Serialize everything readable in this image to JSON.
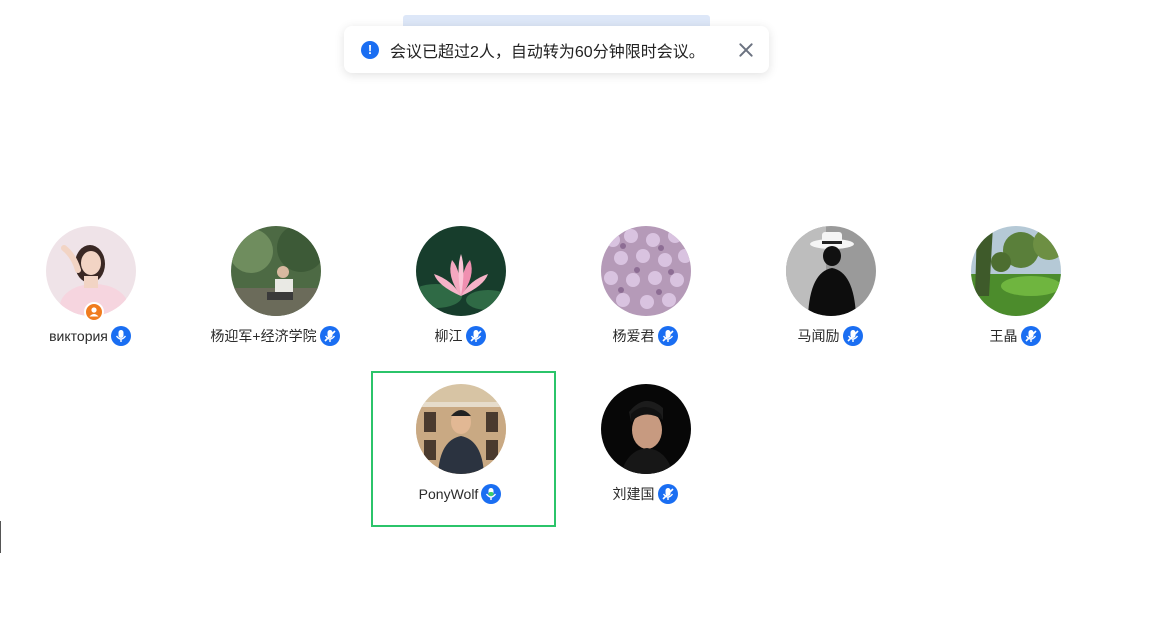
{
  "toast": {
    "message": "会议已超过2人，自动转为60分钟限时会议。",
    "info_icon": "info-icon",
    "close_icon": "close-icon"
  },
  "colors": {
    "accent": "#1a6ef2",
    "active_speaker": "#2bc46a",
    "host_badge": "#f07c1e"
  },
  "participants": [
    {
      "name": "виктория",
      "mic": "mic-active-icon",
      "host": true
    },
    {
      "name": "杨迎军+经济学院",
      "mic": "mic-muted-icon"
    },
    {
      "name": "柳江",
      "mic": "mic-muted-icon"
    },
    {
      "name": "杨爱君",
      "mic": "mic-muted-icon"
    },
    {
      "name": "马闻励",
      "mic": "mic-muted-icon"
    },
    {
      "name": "王晶",
      "mic": "mic-muted-icon"
    },
    {
      "name": "PonyWolf",
      "mic": "mic-speaking-icon",
      "speaking": true
    },
    {
      "name": "刘建国",
      "mic": "mic-muted-icon"
    }
  ]
}
